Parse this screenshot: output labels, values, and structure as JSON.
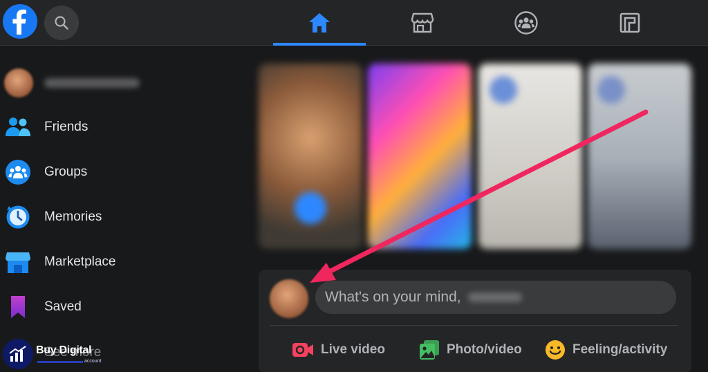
{
  "topbar": {
    "tabs": [
      {
        "name": "home",
        "active": true
      },
      {
        "name": "marketplace",
        "active": false
      },
      {
        "name": "groups",
        "active": false
      },
      {
        "name": "gaming",
        "active": false
      }
    ]
  },
  "sidebar": {
    "items": [
      {
        "label": "Friends",
        "icon": "friends-icon"
      },
      {
        "label": "Groups",
        "icon": "groups-icon"
      },
      {
        "label": "Memories",
        "icon": "memories-icon"
      },
      {
        "label": "Marketplace",
        "icon": "marketplace-icon"
      },
      {
        "label": "Saved",
        "icon": "saved-icon"
      },
      {
        "label": "See more",
        "icon": "chevron-down-icon"
      }
    ]
  },
  "composer": {
    "prompt": "What's on your mind,",
    "actions": [
      {
        "label": "Live video",
        "icon": "live-video-icon",
        "color": "#f3425f"
      },
      {
        "label": "Photo/video",
        "icon": "photo-video-icon",
        "color": "#45bd62"
      },
      {
        "label": "Feeling/activity",
        "icon": "feeling-icon",
        "color": "#f7b928"
      }
    ]
  },
  "watermark": {
    "title": "Buy Digital",
    "subtitle": "account"
  },
  "colors": {
    "accent": "#2d88ff",
    "arrow": "#f0265f",
    "background": "#18191a",
    "surface": "#242526"
  }
}
